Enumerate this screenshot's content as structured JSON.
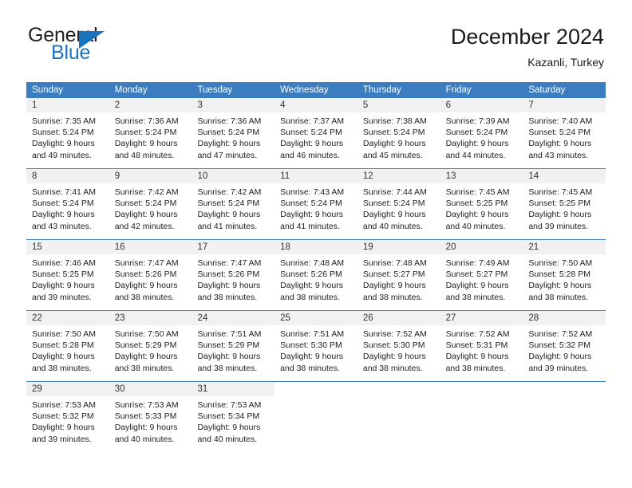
{
  "brand": {
    "name_part1": "General",
    "name_part2": "Blue",
    "accent_color": "#1b74bb"
  },
  "header": {
    "title": "December 2024",
    "location": "Kazanli, Turkey"
  },
  "theme": {
    "header_row_bg": "#3b7dc0",
    "daynum_bg": "#f1f1f1",
    "week_divider": "#3b7dc0"
  },
  "weekdays": [
    "Sunday",
    "Monday",
    "Tuesday",
    "Wednesday",
    "Thursday",
    "Friday",
    "Saturday"
  ],
  "weeks": [
    {
      "days": [
        {
          "num": "1",
          "sunrise": "Sunrise: 7:35 AM",
          "sunset": "Sunset: 5:24 PM",
          "daylight1": "Daylight: 9 hours",
          "daylight2": "and 49 minutes."
        },
        {
          "num": "2",
          "sunrise": "Sunrise: 7:36 AM",
          "sunset": "Sunset: 5:24 PM",
          "daylight1": "Daylight: 9 hours",
          "daylight2": "and 48 minutes."
        },
        {
          "num": "3",
          "sunrise": "Sunrise: 7:36 AM",
          "sunset": "Sunset: 5:24 PM",
          "daylight1": "Daylight: 9 hours",
          "daylight2": "and 47 minutes."
        },
        {
          "num": "4",
          "sunrise": "Sunrise: 7:37 AM",
          "sunset": "Sunset: 5:24 PM",
          "daylight1": "Daylight: 9 hours",
          "daylight2": "and 46 minutes."
        },
        {
          "num": "5",
          "sunrise": "Sunrise: 7:38 AM",
          "sunset": "Sunset: 5:24 PM",
          "daylight1": "Daylight: 9 hours",
          "daylight2": "and 45 minutes."
        },
        {
          "num": "6",
          "sunrise": "Sunrise: 7:39 AM",
          "sunset": "Sunset: 5:24 PM",
          "daylight1": "Daylight: 9 hours",
          "daylight2": "and 44 minutes."
        },
        {
          "num": "7",
          "sunrise": "Sunrise: 7:40 AM",
          "sunset": "Sunset: 5:24 PM",
          "daylight1": "Daylight: 9 hours",
          "daylight2": "and 43 minutes."
        }
      ]
    },
    {
      "days": [
        {
          "num": "8",
          "sunrise": "Sunrise: 7:41 AM",
          "sunset": "Sunset: 5:24 PM",
          "daylight1": "Daylight: 9 hours",
          "daylight2": "and 43 minutes."
        },
        {
          "num": "9",
          "sunrise": "Sunrise: 7:42 AM",
          "sunset": "Sunset: 5:24 PM",
          "daylight1": "Daylight: 9 hours",
          "daylight2": "and 42 minutes."
        },
        {
          "num": "10",
          "sunrise": "Sunrise: 7:42 AM",
          "sunset": "Sunset: 5:24 PM",
          "daylight1": "Daylight: 9 hours",
          "daylight2": "and 41 minutes."
        },
        {
          "num": "11",
          "sunrise": "Sunrise: 7:43 AM",
          "sunset": "Sunset: 5:24 PM",
          "daylight1": "Daylight: 9 hours",
          "daylight2": "and 41 minutes."
        },
        {
          "num": "12",
          "sunrise": "Sunrise: 7:44 AM",
          "sunset": "Sunset: 5:24 PM",
          "daylight1": "Daylight: 9 hours",
          "daylight2": "and 40 minutes."
        },
        {
          "num": "13",
          "sunrise": "Sunrise: 7:45 AM",
          "sunset": "Sunset: 5:25 PM",
          "daylight1": "Daylight: 9 hours",
          "daylight2": "and 40 minutes."
        },
        {
          "num": "14",
          "sunrise": "Sunrise: 7:45 AM",
          "sunset": "Sunset: 5:25 PM",
          "daylight1": "Daylight: 9 hours",
          "daylight2": "and 39 minutes."
        }
      ]
    },
    {
      "days": [
        {
          "num": "15",
          "sunrise": "Sunrise: 7:46 AM",
          "sunset": "Sunset: 5:25 PM",
          "daylight1": "Daylight: 9 hours",
          "daylight2": "and 39 minutes."
        },
        {
          "num": "16",
          "sunrise": "Sunrise: 7:47 AM",
          "sunset": "Sunset: 5:26 PM",
          "daylight1": "Daylight: 9 hours",
          "daylight2": "and 38 minutes."
        },
        {
          "num": "17",
          "sunrise": "Sunrise: 7:47 AM",
          "sunset": "Sunset: 5:26 PM",
          "daylight1": "Daylight: 9 hours",
          "daylight2": "and 38 minutes."
        },
        {
          "num": "18",
          "sunrise": "Sunrise: 7:48 AM",
          "sunset": "Sunset: 5:26 PM",
          "daylight1": "Daylight: 9 hours",
          "daylight2": "and 38 minutes."
        },
        {
          "num": "19",
          "sunrise": "Sunrise: 7:48 AM",
          "sunset": "Sunset: 5:27 PM",
          "daylight1": "Daylight: 9 hours",
          "daylight2": "and 38 minutes."
        },
        {
          "num": "20",
          "sunrise": "Sunrise: 7:49 AM",
          "sunset": "Sunset: 5:27 PM",
          "daylight1": "Daylight: 9 hours",
          "daylight2": "and 38 minutes."
        },
        {
          "num": "21",
          "sunrise": "Sunrise: 7:50 AM",
          "sunset": "Sunset: 5:28 PM",
          "daylight1": "Daylight: 9 hours",
          "daylight2": "and 38 minutes."
        }
      ]
    },
    {
      "days": [
        {
          "num": "22",
          "sunrise": "Sunrise: 7:50 AM",
          "sunset": "Sunset: 5:28 PM",
          "daylight1": "Daylight: 9 hours",
          "daylight2": "and 38 minutes."
        },
        {
          "num": "23",
          "sunrise": "Sunrise: 7:50 AM",
          "sunset": "Sunset: 5:29 PM",
          "daylight1": "Daylight: 9 hours",
          "daylight2": "and 38 minutes."
        },
        {
          "num": "24",
          "sunrise": "Sunrise: 7:51 AM",
          "sunset": "Sunset: 5:29 PM",
          "daylight1": "Daylight: 9 hours",
          "daylight2": "and 38 minutes."
        },
        {
          "num": "25",
          "sunrise": "Sunrise: 7:51 AM",
          "sunset": "Sunset: 5:30 PM",
          "daylight1": "Daylight: 9 hours",
          "daylight2": "and 38 minutes."
        },
        {
          "num": "26",
          "sunrise": "Sunrise: 7:52 AM",
          "sunset": "Sunset: 5:30 PM",
          "daylight1": "Daylight: 9 hours",
          "daylight2": "and 38 minutes."
        },
        {
          "num": "27",
          "sunrise": "Sunrise: 7:52 AM",
          "sunset": "Sunset: 5:31 PM",
          "daylight1": "Daylight: 9 hours",
          "daylight2": "and 38 minutes."
        },
        {
          "num": "28",
          "sunrise": "Sunrise: 7:52 AM",
          "sunset": "Sunset: 5:32 PM",
          "daylight1": "Daylight: 9 hours",
          "daylight2": "and 39 minutes."
        }
      ]
    },
    {
      "days": [
        {
          "num": "29",
          "sunrise": "Sunrise: 7:53 AM",
          "sunset": "Sunset: 5:32 PM",
          "daylight1": "Daylight: 9 hours",
          "daylight2": "and 39 minutes."
        },
        {
          "num": "30",
          "sunrise": "Sunrise: 7:53 AM",
          "sunset": "Sunset: 5:33 PM",
          "daylight1": "Daylight: 9 hours",
          "daylight2": "and 40 minutes."
        },
        {
          "num": "31",
          "sunrise": "Sunrise: 7:53 AM",
          "sunset": "Sunset: 5:34 PM",
          "daylight1": "Daylight: 9 hours",
          "daylight2": "and 40 minutes."
        },
        {
          "num": "",
          "sunrise": "",
          "sunset": "",
          "daylight1": "",
          "daylight2": ""
        },
        {
          "num": "",
          "sunrise": "",
          "sunset": "",
          "daylight1": "",
          "daylight2": ""
        },
        {
          "num": "",
          "sunrise": "",
          "sunset": "",
          "daylight1": "",
          "daylight2": ""
        },
        {
          "num": "",
          "sunrise": "",
          "sunset": "",
          "daylight1": "",
          "daylight2": ""
        }
      ]
    }
  ]
}
